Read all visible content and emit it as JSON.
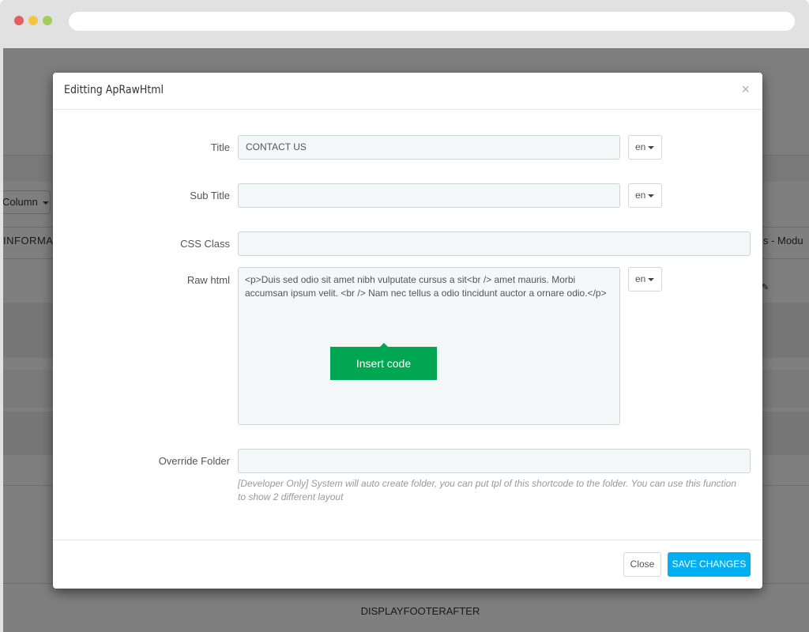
{
  "browser": {
    "url": ""
  },
  "background": {
    "column_button": "Column",
    "information_text": "INFORMAT",
    "module_text": "s - Modu",
    "footer_label": "DISPLAYFOOTERAFTER"
  },
  "modal": {
    "title": "Editting ApRawHtml",
    "close_icon": "×",
    "fields": {
      "title": {
        "label": "Title",
        "value": "CONTACT US",
        "lang": "en"
      },
      "sub_title": {
        "label": "Sub Title",
        "value": "",
        "lang": "en"
      },
      "css_class": {
        "label": "CSS Class",
        "value": ""
      },
      "raw_html": {
        "label": "Raw html",
        "value": "<p>Duis sed odio sit amet nibh vulputate cursus a sit<br /> amet mauris. Morbi accumsan ipsum velit. <br /> Nam nec tellus a odio tincidunt auctor a ornare odio.</p>",
        "lang": "en"
      },
      "override_folder": {
        "label": "Override Folder",
        "value": "",
        "help": "[Developer Only] System will auto create folder, you can put tpl of this shortcode to the folder. You can use this function to show 2 different layout"
      }
    },
    "insert_code_label": "Insert code",
    "footer": {
      "close_label": "Close",
      "save_label": "SAVE CHANGES"
    }
  },
  "colors": {
    "primary": "#00aff0",
    "insert_code": "#00a651"
  }
}
